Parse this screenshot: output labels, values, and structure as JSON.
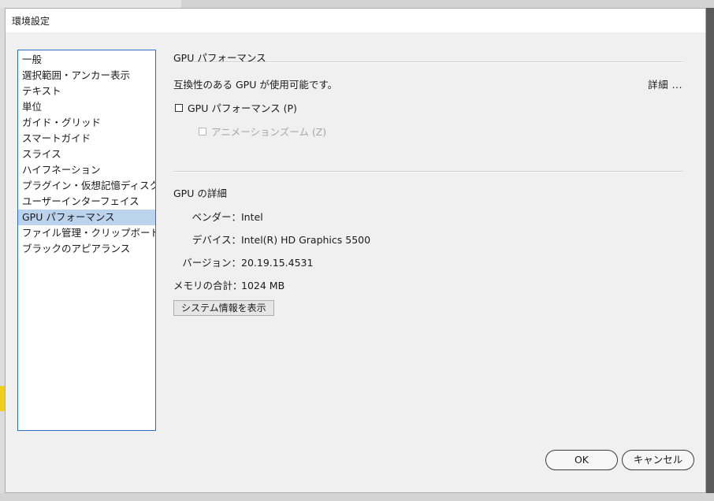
{
  "window": {
    "title": "環境設定"
  },
  "sidebar": {
    "items": [
      {
        "label": "一般"
      },
      {
        "label": "選択範囲・アンカー表示"
      },
      {
        "label": "テキスト"
      },
      {
        "label": "単位"
      },
      {
        "label": "ガイド・グリッド"
      },
      {
        "label": "スマートガイド"
      },
      {
        "label": "スライス"
      },
      {
        "label": "ハイフネーション"
      },
      {
        "label": "プラグイン・仮想記憶ディスク"
      },
      {
        "label": "ユーザーインターフェイス"
      },
      {
        "label": "GPU パフォーマンス",
        "selected": true
      },
      {
        "label": "ファイル管理・クリップボード"
      },
      {
        "label": "ブラックのアピアランス"
      }
    ]
  },
  "main": {
    "section_title": "GPU パフォーマンス",
    "availability_text": "互換性のある GPU が使用可能です。",
    "details_link": "詳細 ...",
    "gpu_checkbox": {
      "label": "GPU パフォーマンス (P)",
      "checked": false
    },
    "anim_checkbox": {
      "label": "アニメーションズーム (Z)",
      "checked": false,
      "disabled": true
    },
    "details_title": "GPU の詳細",
    "info": {
      "vendor_label": "ベンダー：",
      "vendor_value": "Intel",
      "device_label": "デバイス：",
      "device_value": "Intel(R) HD Graphics 5500",
      "version_label": "バージョン：",
      "version_value": "20.19.15.4531",
      "memory_label": "メモリの合計：",
      "memory_value": "1024 MB"
    },
    "sysinfo_button": "システム情報を表示"
  },
  "footer": {
    "ok_label": "OK",
    "cancel_label": "キャンセル"
  }
}
